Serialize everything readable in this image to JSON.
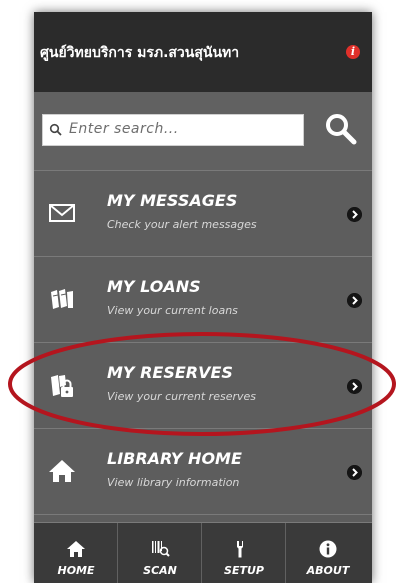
{
  "header": {
    "title": "ศูนย์วิทยบริการ มรภ.สวนสุนันทา",
    "info_icon": "info-icon",
    "info_icon_glyph": "i"
  },
  "search": {
    "placeholder": "Enter search...",
    "icon": "search-icon"
  },
  "menu": [
    {
      "title": "MY MESSAGES",
      "subtitle": "Check your alert messages",
      "icon": "envelope-icon"
    },
    {
      "title": "MY LOANS",
      "subtitle": "View your current loans",
      "icon": "books-icon"
    },
    {
      "title": "MY RESERVES",
      "subtitle": "View your current reserves",
      "icon": "lock-books-icon",
      "highlighted": true
    },
    {
      "title": "LIBRARY HOME",
      "subtitle": "View library information",
      "icon": "home-icon"
    }
  ],
  "footer": {
    "tabs": [
      {
        "label": "HOME",
        "icon": "home-icon"
      },
      {
        "label": "SCAN",
        "icon": "barcode-icon"
      },
      {
        "label": "SETUP",
        "icon": "wrench-icon"
      },
      {
        "label": "ABOUT",
        "icon": "info-icon"
      }
    ]
  },
  "colors": {
    "header_bg": "#2b2b2b",
    "body_bg": "#5d5d5d",
    "footer_bg": "#3a3a3a",
    "highlight_ellipse": "#b4151e",
    "info_accent": "#e0302a"
  }
}
